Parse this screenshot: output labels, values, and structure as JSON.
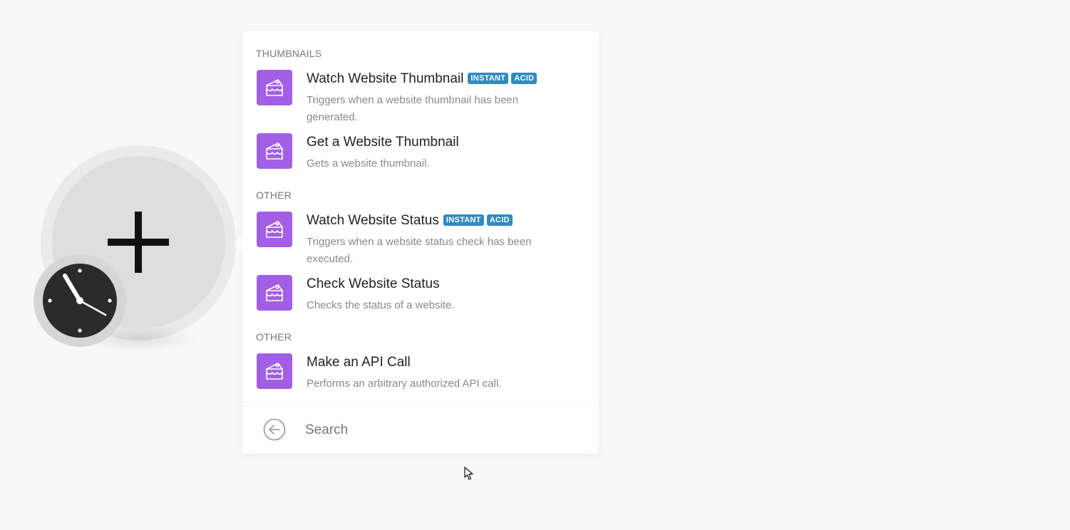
{
  "module": {
    "plus_icon": "plus-icon",
    "badge_icon": "clock-icon",
    "colors": {
      "halo": "#eaeaea",
      "circle": "#dedede",
      "clock_face": "#2b2b2b"
    }
  },
  "panel": {
    "sections": [
      {
        "header": "THUMBNAILS",
        "items": [
          {
            "title": "Watch Website Thumbnail",
            "badges": [
              "INSTANT",
              "ACID"
            ],
            "description": "Triggers when a website thumbnail has been generated.",
            "icon": "cake-icon"
          },
          {
            "title": "Get a Website Thumbnail",
            "badges": [],
            "description": "Gets a website thumbnail.",
            "icon": "cake-icon"
          }
        ]
      },
      {
        "header": "OTHER",
        "items": [
          {
            "title": "Watch Website Status",
            "badges": [
              "INSTANT",
              "ACID"
            ],
            "description": "Triggers when a website status check has been executed.",
            "icon": "cake-icon"
          },
          {
            "title": "Check Website Status",
            "badges": [],
            "description": "Checks the status of a website.",
            "icon": "cake-icon"
          }
        ]
      },
      {
        "header": "OTHER",
        "items": [
          {
            "title": "Make an API Call",
            "badges": [],
            "description": "Performs an arbitrary authorized API call.",
            "icon": "cake-icon"
          }
        ]
      }
    ],
    "search": {
      "placeholder": "Search",
      "value": ""
    },
    "colors": {
      "app_icon": "#a35ee6",
      "badge": "#2e8bc0",
      "title": "#222222",
      "description": "#888888",
      "header": "#777777"
    }
  }
}
